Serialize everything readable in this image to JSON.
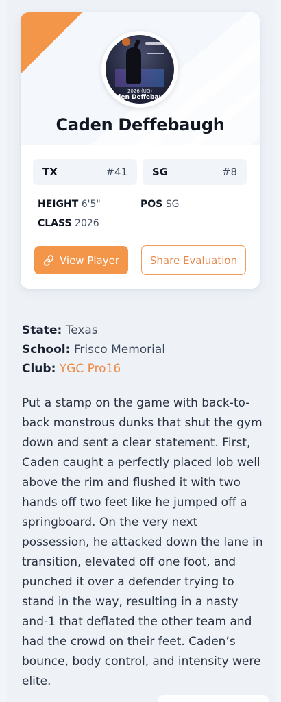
{
  "player": {
    "name": "Caden Deffebaugh",
    "photo_caption_year": "2026 (UG)",
    "photo_caption_name": "Caden Deffebaugh"
  },
  "badges": [
    {
      "label": "TX",
      "value": "#41"
    },
    {
      "label": "SG",
      "value": "#8"
    }
  ],
  "attributes": {
    "height_label": "HEIGHT",
    "height_value": "6'5\"",
    "pos_label": "POS",
    "pos_value": "SG",
    "class_label": "CLASS",
    "class_value": "2026"
  },
  "actions": {
    "view_label": "View Player",
    "share_label": "Share Evaluation"
  },
  "details": {
    "state_label": "State:",
    "state_value": "Texas",
    "school_label": "School:",
    "school_value": "Frisco Memorial",
    "club_label": "Club:",
    "club_value": "YGC Pro16"
  },
  "evaluation": "Put a stamp on the game with back-to-back monstrous dunks that shut the gym down and sent a clear statement. First, Caden caught a perfectly placed lob well above the rim and flushed it with two hands off two feet like he jumped off a springboard. On the very next possession, he attacked down the lane in transition, elevated off one foot, and punched it over a defender trying to stand in the way, resulting in a nasty and-1 that deflated the other team and had the crowd on their feet. Caden’s bounce, body control, and intensity were elite.",
  "colors": {
    "accent": "#f3964a",
    "background": "#eef2f7"
  }
}
